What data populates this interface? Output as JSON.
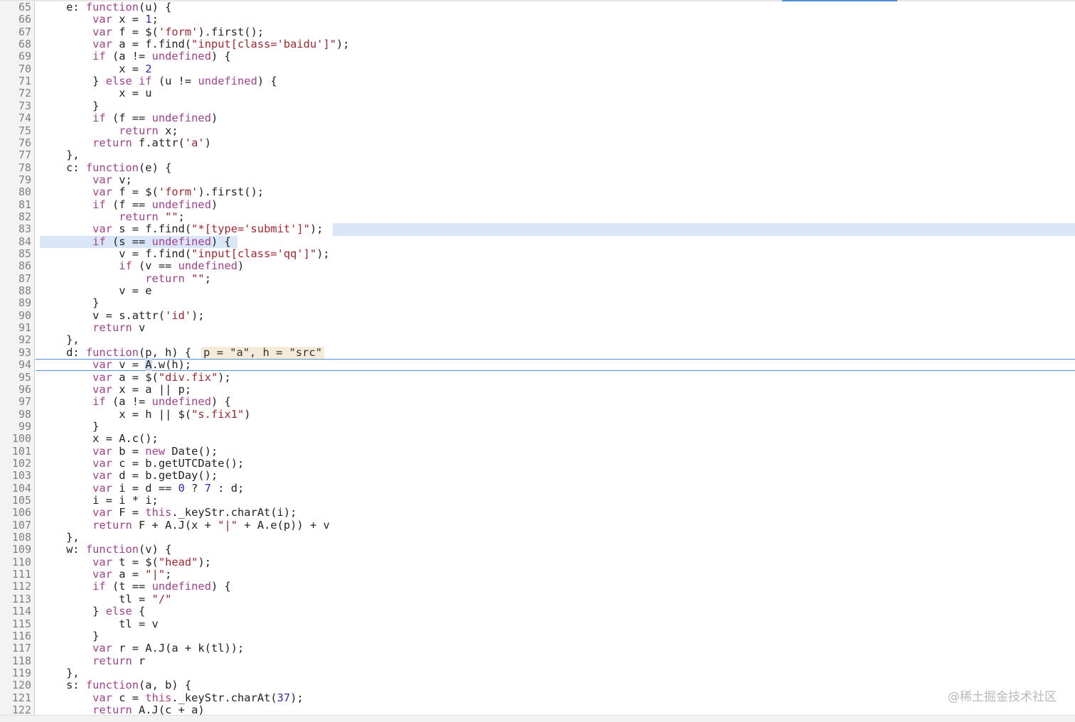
{
  "editor": {
    "highlight_color": "#d8e6f7",
    "paused_line": 94,
    "watermark": "@稀土掘金技术社区",
    "lines": [
      {
        "n": "65",
        "indent": 4,
        "tokens": [
          [
            "p",
            "e: "
          ],
          [
            "k",
            "function"
          ],
          [
            "p",
            "(u) {"
          ]
        ]
      },
      {
        "n": "66",
        "indent": 8,
        "tokens": [
          [
            "k",
            "var"
          ],
          [
            "p",
            " x = "
          ],
          [
            "n",
            "1"
          ],
          [
            "p",
            ";"
          ]
        ]
      },
      {
        "n": "67",
        "indent": 8,
        "tokens": [
          [
            "k",
            "var"
          ],
          [
            "p",
            " f = $("
          ],
          [
            "s",
            "'form'"
          ],
          [
            "p",
            ").first();"
          ]
        ]
      },
      {
        "n": "68",
        "indent": 8,
        "tokens": [
          [
            "k",
            "var"
          ],
          [
            "p",
            " a = f.find("
          ],
          [
            "s",
            "\"input[class='baidu']\""
          ],
          [
            "p",
            ");"
          ]
        ]
      },
      {
        "n": "69",
        "indent": 8,
        "tokens": [
          [
            "k",
            "if"
          ],
          [
            "p",
            " (a != "
          ],
          [
            "k",
            "undefined"
          ],
          [
            "p",
            ") {"
          ]
        ]
      },
      {
        "n": "70",
        "indent": 12,
        "tokens": [
          [
            "p",
            "x = "
          ],
          [
            "n",
            "2"
          ]
        ]
      },
      {
        "n": "71",
        "indent": 8,
        "tokens": [
          [
            "p",
            "} "
          ],
          [
            "k",
            "else if"
          ],
          [
            "p",
            " (u != "
          ],
          [
            "k",
            "undefined"
          ],
          [
            "p",
            ") {"
          ]
        ]
      },
      {
        "n": "72",
        "indent": 12,
        "tokens": [
          [
            "p",
            "x = u"
          ]
        ]
      },
      {
        "n": "73",
        "indent": 8,
        "tokens": [
          [
            "p",
            "}"
          ]
        ]
      },
      {
        "n": "74",
        "indent": 8,
        "tokens": [
          [
            "k",
            "if"
          ],
          [
            "p",
            " (f == "
          ],
          [
            "k",
            "undefined"
          ],
          [
            "p",
            ")"
          ]
        ]
      },
      {
        "n": "75",
        "indent": 12,
        "tokens": [
          [
            "k",
            "return"
          ],
          [
            "p",
            " x;"
          ]
        ]
      },
      {
        "n": "76",
        "indent": 8,
        "tokens": [
          [
            "k",
            "return"
          ],
          [
            "p",
            " f.attr("
          ],
          [
            "s",
            "'a'"
          ],
          [
            "p",
            ")"
          ]
        ]
      },
      {
        "n": "77",
        "indent": 4,
        "tokens": [
          [
            "p",
            "},"
          ]
        ]
      },
      {
        "n": "78",
        "indent": 4,
        "tokens": [
          [
            "p",
            "c: "
          ],
          [
            "k",
            "function"
          ],
          [
            "p",
            "(e) {"
          ]
        ]
      },
      {
        "n": "79",
        "indent": 8,
        "tokens": [
          [
            "k",
            "var"
          ],
          [
            "p",
            " v;"
          ]
        ]
      },
      {
        "n": "80",
        "indent": 8,
        "tokens": [
          [
            "k",
            "var"
          ],
          [
            "p",
            " f = $("
          ],
          [
            "s",
            "'form'"
          ],
          [
            "p",
            ").first();"
          ]
        ]
      },
      {
        "n": "81",
        "indent": 8,
        "tokens": [
          [
            "k",
            "if"
          ],
          [
            "p",
            " (f == "
          ],
          [
            "k",
            "undefined"
          ],
          [
            "p",
            ")"
          ]
        ]
      },
      {
        "n": "82",
        "indent": 12,
        "tokens": [
          [
            "k",
            "return"
          ],
          [
            "p",
            " "
          ],
          [
            "s",
            "\"\""
          ],
          [
            "p",
            ";"
          ]
        ]
      },
      {
        "n": "83",
        "indent": 8,
        "hl": "83",
        "tokens": [
          [
            "k",
            "var"
          ],
          [
            "p",
            " s = f.find("
          ],
          [
            "s",
            "\"*[type='submit']\""
          ],
          [
            "p",
            ");"
          ]
        ]
      },
      {
        "n": "84",
        "indent": 8,
        "hl": "84",
        "tokens": [
          [
            "k",
            "if"
          ],
          [
            "p",
            " (s == "
          ],
          [
            "k",
            "undefined"
          ],
          [
            "p",
            ") {"
          ]
        ]
      },
      {
        "n": "85",
        "indent": 12,
        "tokens": [
          [
            "p",
            "v = f.find("
          ],
          [
            "s",
            "\"input[class='qq']\""
          ],
          [
            "p",
            ");"
          ]
        ]
      },
      {
        "n": "86",
        "indent": 12,
        "tokens": [
          [
            "k",
            "if"
          ],
          [
            "p",
            " (v == "
          ],
          [
            "k",
            "undefined"
          ],
          [
            "p",
            ")"
          ]
        ]
      },
      {
        "n": "87",
        "indent": 16,
        "tokens": [
          [
            "k",
            "return"
          ],
          [
            "p",
            " "
          ],
          [
            "s",
            "\"\""
          ],
          [
            "p",
            ";"
          ]
        ]
      },
      {
        "n": "88",
        "indent": 12,
        "tokens": [
          [
            "p",
            "v = e"
          ]
        ]
      },
      {
        "n": "89",
        "indent": 8,
        "tokens": [
          [
            "p",
            "}"
          ]
        ]
      },
      {
        "n": "90",
        "indent": 8,
        "tokens": [
          [
            "p",
            "v = s.attr("
          ],
          [
            "s",
            "'id'"
          ],
          [
            "p",
            ");"
          ]
        ]
      },
      {
        "n": "91",
        "indent": 8,
        "tokens": [
          [
            "k",
            "return"
          ],
          [
            "p",
            " v"
          ]
        ]
      },
      {
        "n": "92",
        "indent": 4,
        "tokens": [
          [
            "p",
            "},"
          ]
        ]
      },
      {
        "n": "93",
        "indent": 4,
        "tokens": [
          [
            "p",
            "d: "
          ],
          [
            "k",
            "function"
          ],
          [
            "p",
            "(p, h) {"
          ],
          [
            "a",
            "p = \"a\", h = \"src\""
          ]
        ]
      },
      {
        "n": "94",
        "indent": 8,
        "current": true,
        "tokens": [
          [
            "k",
            "var"
          ],
          [
            "p",
            " v = "
          ],
          [
            "c",
            "A"
          ],
          [
            "p",
            ".w(h);"
          ]
        ]
      },
      {
        "n": "95",
        "indent": 8,
        "tokens": [
          [
            "k",
            "var"
          ],
          [
            "p",
            " a = $("
          ],
          [
            "s",
            "\"div.fix\""
          ],
          [
            "p",
            ");"
          ]
        ]
      },
      {
        "n": "96",
        "indent": 8,
        "tokens": [
          [
            "k",
            "var"
          ],
          [
            "p",
            " x = a || p;"
          ]
        ]
      },
      {
        "n": "97",
        "indent": 8,
        "tokens": [
          [
            "k",
            "if"
          ],
          [
            "p",
            " (a != "
          ],
          [
            "k",
            "undefined"
          ],
          [
            "p",
            ") {"
          ]
        ]
      },
      {
        "n": "98",
        "indent": 12,
        "tokens": [
          [
            "p",
            "x = h || $("
          ],
          [
            "s",
            "\"s.fix1\""
          ],
          [
            "p",
            ")"
          ]
        ]
      },
      {
        "n": "99",
        "indent": 8,
        "tokens": [
          [
            "p",
            "}"
          ]
        ]
      },
      {
        "n": "100",
        "indent": 8,
        "tokens": [
          [
            "p",
            "x = A.c();"
          ]
        ]
      },
      {
        "n": "101",
        "indent": 8,
        "tokens": [
          [
            "k",
            "var"
          ],
          [
            "p",
            " b = "
          ],
          [
            "k",
            "new"
          ],
          [
            "p",
            " Date();"
          ]
        ]
      },
      {
        "n": "102",
        "indent": 8,
        "tokens": [
          [
            "k",
            "var"
          ],
          [
            "p",
            " c = b.getUTCDate();"
          ]
        ]
      },
      {
        "n": "103",
        "indent": 8,
        "tokens": [
          [
            "k",
            "var"
          ],
          [
            "p",
            " d = b.getDay();"
          ]
        ]
      },
      {
        "n": "104",
        "indent": 8,
        "tokens": [
          [
            "k",
            "var"
          ],
          [
            "p",
            " i = d == "
          ],
          [
            "n",
            "0"
          ],
          [
            "p",
            " ? "
          ],
          [
            "n",
            "7"
          ],
          [
            "p",
            " : d;"
          ]
        ]
      },
      {
        "n": "105",
        "indent": 8,
        "tokens": [
          [
            "p",
            "i = i * i;"
          ]
        ]
      },
      {
        "n": "106",
        "indent": 8,
        "tokens": [
          [
            "k",
            "var"
          ],
          [
            "p",
            " F = "
          ],
          [
            "k",
            "this"
          ],
          [
            "p",
            "._keyStr.charAt(i);"
          ]
        ]
      },
      {
        "n": "107",
        "indent": 8,
        "tokens": [
          [
            "k",
            "return"
          ],
          [
            "p",
            " F + A.J(x + "
          ],
          [
            "s",
            "\"|\""
          ],
          [
            "p",
            " + A.e(p)) + v"
          ]
        ]
      },
      {
        "n": "108",
        "indent": 4,
        "tokens": [
          [
            "p",
            "},"
          ]
        ]
      },
      {
        "n": "109",
        "indent": 4,
        "tokens": [
          [
            "p",
            "w: "
          ],
          [
            "k",
            "function"
          ],
          [
            "p",
            "(v) {"
          ]
        ]
      },
      {
        "n": "110",
        "indent": 8,
        "tokens": [
          [
            "k",
            "var"
          ],
          [
            "p",
            " t = $("
          ],
          [
            "s",
            "\"head\""
          ],
          [
            "p",
            ");"
          ]
        ]
      },
      {
        "n": "111",
        "indent": 8,
        "tokens": [
          [
            "k",
            "var"
          ],
          [
            "p",
            " a = "
          ],
          [
            "s",
            "\"|\""
          ],
          [
            "p",
            ";"
          ]
        ]
      },
      {
        "n": "112",
        "indent": 8,
        "tokens": [
          [
            "k",
            "if"
          ],
          [
            "p",
            " (t == "
          ],
          [
            "k",
            "undefined"
          ],
          [
            "p",
            ") {"
          ]
        ]
      },
      {
        "n": "113",
        "indent": 12,
        "tokens": [
          [
            "p",
            "tl = "
          ],
          [
            "s",
            "\"/\""
          ]
        ]
      },
      {
        "n": "114",
        "indent": 8,
        "tokens": [
          [
            "p",
            "} "
          ],
          [
            "k",
            "else"
          ],
          [
            "p",
            " {"
          ]
        ]
      },
      {
        "n": "115",
        "indent": 12,
        "tokens": [
          [
            "p",
            "tl = v"
          ]
        ]
      },
      {
        "n": "116",
        "indent": 8,
        "tokens": [
          [
            "p",
            "}"
          ]
        ]
      },
      {
        "n": "117",
        "indent": 8,
        "tokens": [
          [
            "k",
            "var"
          ],
          [
            "p",
            " r = A.J(a + k(tl));"
          ]
        ]
      },
      {
        "n": "118",
        "indent": 8,
        "tokens": [
          [
            "k",
            "return"
          ],
          [
            "p",
            " r"
          ]
        ]
      },
      {
        "n": "119",
        "indent": 4,
        "tokens": [
          [
            "p",
            "},"
          ]
        ]
      },
      {
        "n": "120",
        "indent": 4,
        "tokens": [
          [
            "p",
            "s: "
          ],
          [
            "k",
            "function"
          ],
          [
            "p",
            "(a, b) {"
          ]
        ]
      },
      {
        "n": "121",
        "indent": 8,
        "tokens": [
          [
            "k",
            "var"
          ],
          [
            "p",
            " c = "
          ],
          [
            "k",
            "this"
          ],
          [
            "p",
            "._keyStr.charAt("
          ],
          [
            "n",
            "37"
          ],
          [
            "p",
            ");"
          ]
        ]
      },
      {
        "n": "122",
        "indent": 8,
        "tokens": [
          [
            "k",
            "return"
          ],
          [
            "p",
            " A.J(c + a)"
          ]
        ]
      }
    ]
  }
}
